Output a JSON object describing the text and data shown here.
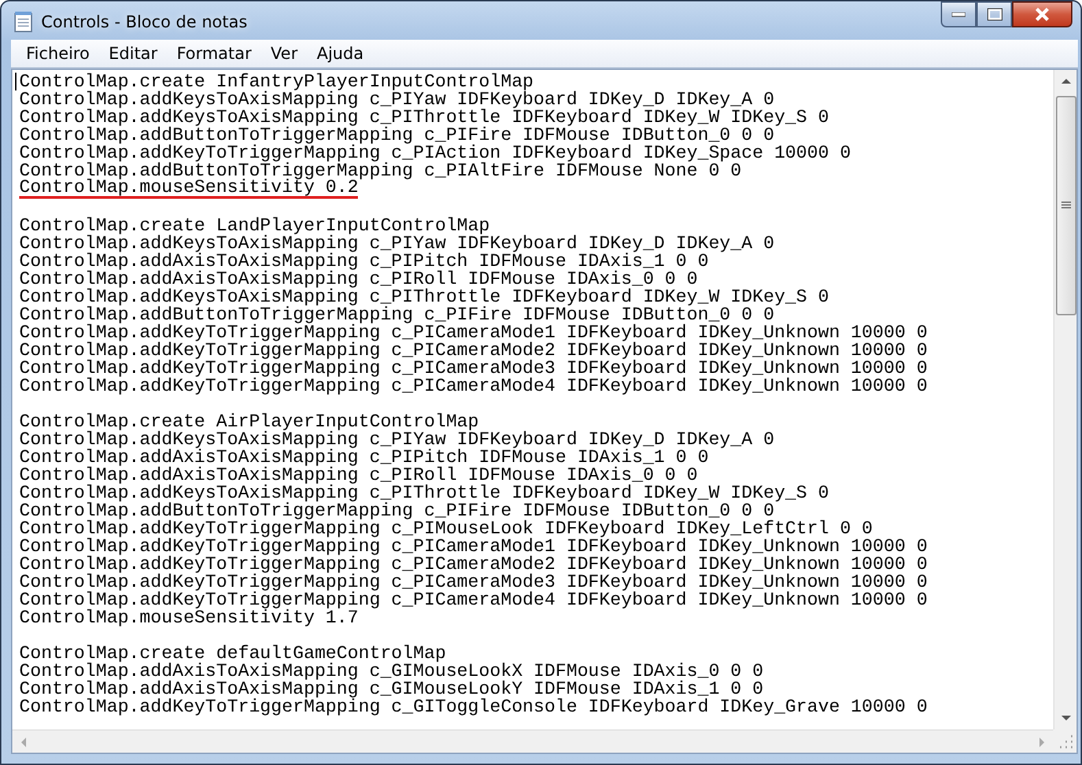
{
  "window": {
    "title": "Controls - Bloco de notas"
  },
  "menu": [
    {
      "label": "Ficheiro"
    },
    {
      "label": "Editar"
    },
    {
      "label": "Formatar"
    },
    {
      "label": "Ver"
    },
    {
      "label": "Ajuda"
    }
  ],
  "document": {
    "blocks": [
      {
        "lines": [
          {
            "text": "ControlMap.create InfantryPlayerInputControlMap",
            "underlined": false
          },
          {
            "text": "ControlMap.addKeysToAxisMapping c_PIYaw IDFKeyboard IDKey_D IDKey_A 0",
            "underlined": false
          },
          {
            "text": "ControlMap.addKeysToAxisMapping c_PIThrottle IDFKeyboard IDKey_W IDKey_S 0",
            "underlined": false
          },
          {
            "text": "ControlMap.addButtonToTriggerMapping c_PIFire IDFMouse IDButton_0 0 0",
            "underlined": false
          },
          {
            "text": "ControlMap.addKeyToTriggerMapping c_PIAction IDFKeyboard IDKey_Space 10000 0",
            "underlined": false
          },
          {
            "text": "ControlMap.addButtonToTriggerMapping c_PIAltFire IDFMouse None 0 0",
            "underlined": false
          },
          {
            "text": "ControlMap.mouseSensitivity 0.2",
            "underlined": true
          }
        ]
      },
      {
        "lines": [
          {
            "text": "ControlMap.create LandPlayerInputControlMap",
            "underlined": false
          },
          {
            "text": "ControlMap.addKeysToAxisMapping c_PIYaw IDFKeyboard IDKey_D IDKey_A 0",
            "underlined": false
          },
          {
            "text": "ControlMap.addAxisToAxisMapping c_PIPitch IDFMouse IDAxis_1 0 0",
            "underlined": false
          },
          {
            "text": "ControlMap.addAxisToAxisMapping c_PIRoll IDFMouse IDAxis_0 0 0",
            "underlined": false
          },
          {
            "text": "ControlMap.addKeysToAxisMapping c_PIThrottle IDFKeyboard IDKey_W IDKey_S 0",
            "underlined": false
          },
          {
            "text": "ControlMap.addButtonToTriggerMapping c_PIFire IDFMouse IDButton_0 0 0",
            "underlined": false
          },
          {
            "text": "ControlMap.addKeyToTriggerMapping c_PICameraMode1 IDFKeyboard IDKey_Unknown 10000 0",
            "underlined": false
          },
          {
            "text": "ControlMap.addKeyToTriggerMapping c_PICameraMode2 IDFKeyboard IDKey_Unknown 10000 0",
            "underlined": false
          },
          {
            "text": "ControlMap.addKeyToTriggerMapping c_PICameraMode3 IDFKeyboard IDKey_Unknown 10000 0",
            "underlined": false
          },
          {
            "text": "ControlMap.addKeyToTriggerMapping c_PICameraMode4 IDFKeyboard IDKey_Unknown 10000 0",
            "underlined": false
          }
        ]
      },
      {
        "lines": [
          {
            "text": "ControlMap.create AirPlayerInputControlMap",
            "underlined": false
          },
          {
            "text": "ControlMap.addKeysToAxisMapping c_PIYaw IDFKeyboard IDKey_D IDKey_A 0",
            "underlined": false
          },
          {
            "text": "ControlMap.addAxisToAxisMapping c_PIPitch IDFMouse IDAxis_1 0 0",
            "underlined": false
          },
          {
            "text": "ControlMap.addAxisToAxisMapping c_PIRoll IDFMouse IDAxis_0 0 0",
            "underlined": false
          },
          {
            "text": "ControlMap.addKeysToAxisMapping c_PIThrottle IDFKeyboard IDKey_W IDKey_S 0",
            "underlined": false
          },
          {
            "text": "ControlMap.addButtonToTriggerMapping c_PIFire IDFMouse IDButton_0 0 0",
            "underlined": false
          },
          {
            "text": "ControlMap.addKeyToTriggerMapping c_PIMouseLook IDFKeyboard IDKey_LeftCtrl 0 0",
            "underlined": false
          },
          {
            "text": "ControlMap.addKeyToTriggerMapping c_PICameraMode1 IDFKeyboard IDKey_Unknown 10000 0",
            "underlined": false
          },
          {
            "text": "ControlMap.addKeyToTriggerMapping c_PICameraMode2 IDFKeyboard IDKey_Unknown 10000 0",
            "underlined": false
          },
          {
            "text": "ControlMap.addKeyToTriggerMapping c_PICameraMode3 IDFKeyboard IDKey_Unknown 10000 0",
            "underlined": false
          },
          {
            "text": "ControlMap.addKeyToTriggerMapping c_PICameraMode4 IDFKeyboard IDKey_Unknown 10000 0",
            "underlined": false
          },
          {
            "text": "ControlMap.mouseSensitivity 1.7",
            "underlined": false
          }
        ]
      },
      {
        "lines": [
          {
            "text": "ControlMap.create defaultGameControlMap",
            "underlined": false
          },
          {
            "text": "ControlMap.addAxisToAxisMapping c_GIMouseLookX IDFMouse IDAxis_0 0 0",
            "underlined": false
          },
          {
            "text": "ControlMap.addAxisToAxisMapping c_GIMouseLookY IDFMouse IDAxis_1 0 0",
            "underlined": false
          },
          {
            "text": "ControlMap.addKeyToTriggerMapping c_GIToggleConsole IDFKeyboard IDKey_Grave 10000 0",
            "underlined": false
          }
        ]
      }
    ]
  }
}
